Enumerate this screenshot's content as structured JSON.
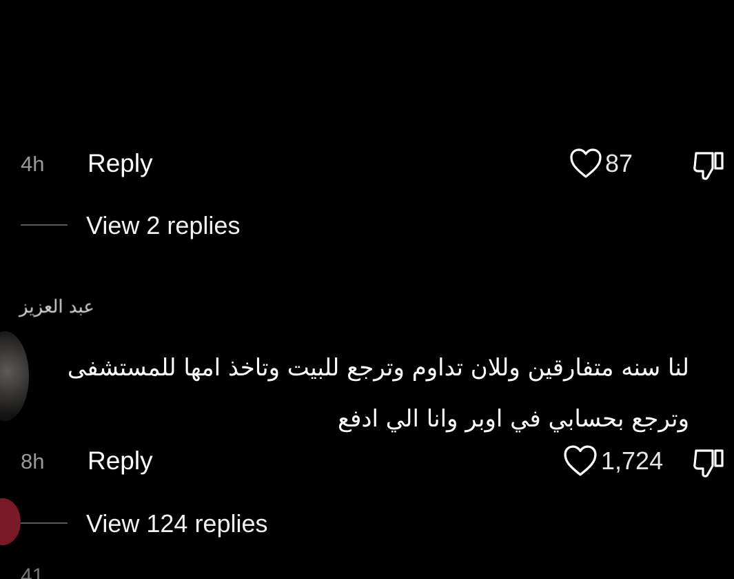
{
  "comments": [
    {
      "time": "4h",
      "reply_label": "Reply",
      "likes": "87",
      "view_replies": "View 2 replies"
    },
    {
      "username": "عبد العزيز",
      "text_line1": "لنا سنه متفارقين وللان تداوم وترجع للبيت وتاخذ امها للمستشفى",
      "text_line2": "وترجع بحسابي في اوبر وانا الي ادفع",
      "time": "8h",
      "reply_label": "Reply",
      "likes": "1,724",
      "view_replies": "View 124 replies"
    }
  ],
  "next_comment_partial": "41",
  "colors": {
    "background": "#000000",
    "primary_text": "#ffffff",
    "secondary_text": "#9a9a9a",
    "divider": "#5a5a5a",
    "heart_badge": "#7a1a28"
  },
  "icons": {
    "like": "heart-outline-icon",
    "dislike": "thumbs-down-outline-icon"
  }
}
